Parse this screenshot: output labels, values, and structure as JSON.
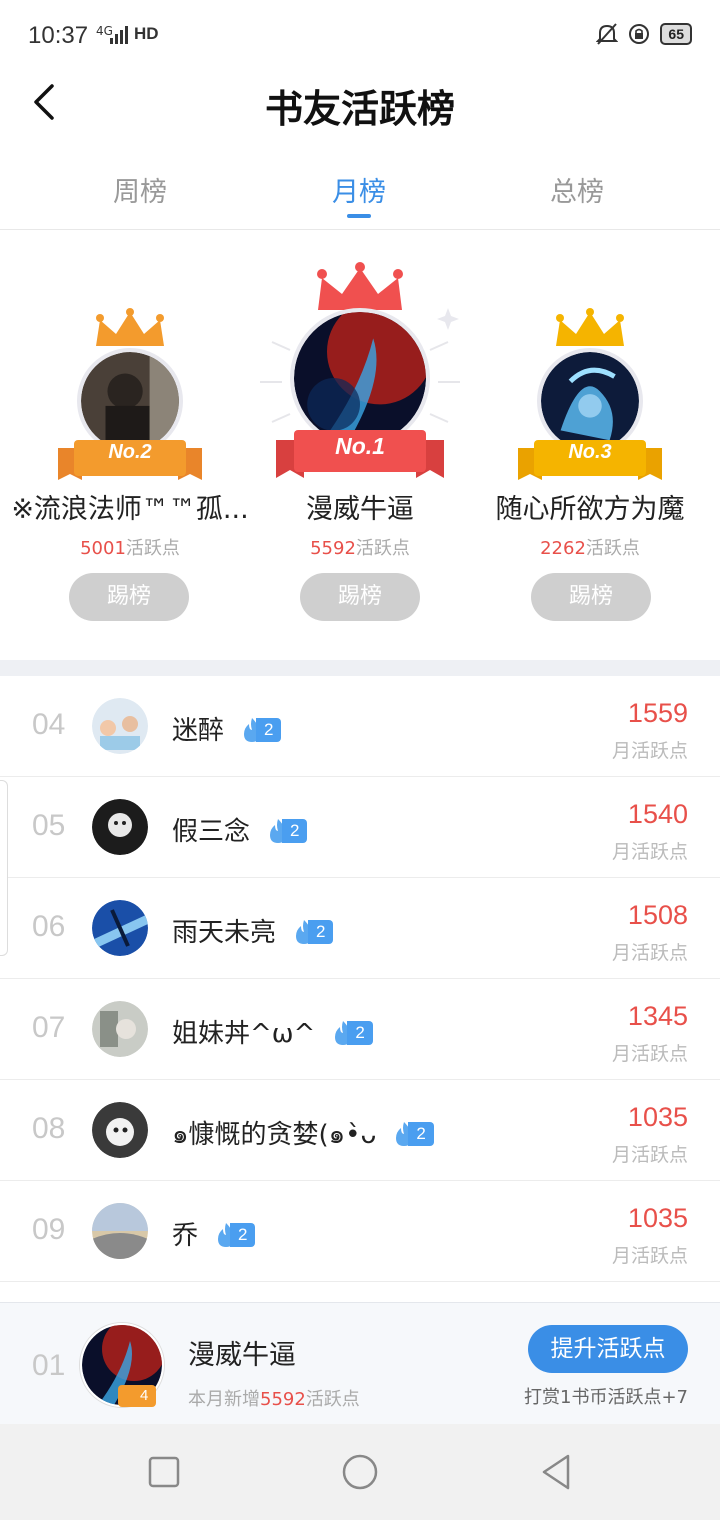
{
  "status_bar": {
    "time": "10:37",
    "network": "4G",
    "hd": "HD",
    "battery": "65"
  },
  "header": {
    "title": "书友活跃榜"
  },
  "tabs": [
    {
      "label": "周榜",
      "active": false
    },
    {
      "label": "月榜",
      "active": true
    },
    {
      "label": "总榜",
      "active": false
    }
  ],
  "podium": {
    "first": {
      "badge": "No.1",
      "name": "漫威牛逼",
      "points": "5592",
      "points_unit": "活跃点",
      "button": "踢榜"
    },
    "second": {
      "badge": "No.2",
      "name": "※流浪法师™™孤...",
      "points": "5001",
      "points_unit": "活跃点",
      "button": "踢榜"
    },
    "third": {
      "badge": "No.3",
      "name": "随心所欲方为魔",
      "points": "2262",
      "points_unit": "活跃点",
      "button": "踢榜"
    }
  },
  "ranking": [
    {
      "rank": "04",
      "name": "迷醉",
      "level": "2",
      "value": "1559",
      "label": "月活跃点"
    },
    {
      "rank": "05",
      "name": "假三念",
      "level": "2",
      "value": "1540",
      "label": "月活跃点"
    },
    {
      "rank": "06",
      "name": "雨天未亮",
      "level": "2",
      "value": "1508",
      "label": "月活跃点"
    },
    {
      "rank": "07",
      "name": "姐妹丼^ω^",
      "level": "2",
      "value": "1345",
      "label": "月活跃点"
    },
    {
      "rank": "08",
      "name": "๑慷慨的贪婪(๑•̀ᴗ",
      "level": "2",
      "value": "1035",
      "label": "月活跃点"
    },
    {
      "rank": "09",
      "name": "乔",
      "level": "2",
      "value": "1035",
      "label": "月活跃点"
    }
  ],
  "me": {
    "rank": "01",
    "name": "漫威牛逼",
    "level": "4",
    "sub_prefix": "本月新增",
    "sub_points": "5592",
    "sub_suffix": "活跃点",
    "boost_button": "提升活跃点",
    "reward_text": "打赏1书币活跃点+7"
  },
  "colors": {
    "accent": "#3a8ee6",
    "value_red": "#e8504a",
    "gold": "#f5b400",
    "silver_orange": "#f39b2d",
    "first_red": "#f0504f"
  }
}
